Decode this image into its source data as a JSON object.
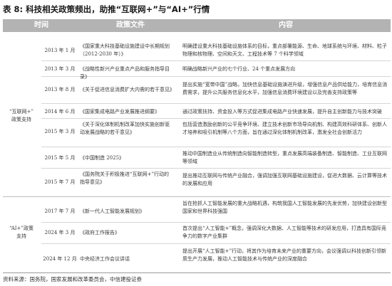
{
  "table": {
    "title_prefix": "表 8:",
    "title_text": "科技相关政策频出，助推“互联网+”与“AI+”行情",
    "headers": {
      "time": "时间",
      "policy": "政策文件",
      "content": "内容"
    },
    "groups": [
      {
        "label_line1": "“互联网+”",
        "label_line2": "政策支持"
      },
      {
        "label_line1": "“AI+”政策",
        "label_line2": "支持"
      }
    ],
    "rows": [
      {
        "date": "2013 年 1 月",
        "policy": "《国家重大科技基础设施建设中长期规划（2012-2030 年）》",
        "content": "明确建设重大科技基础设施体系的目标，重点部署能源、生命、地球系统与环境、材料、粒子物理和核物理、空间和天文、工程技术等 7 个科学领域"
      },
      {
        "date": "2013 年 3 月",
        "policy": "《战略性新兴产业重点产品和服务指导目录》",
        "content": "明确战略新兴产业的七个行业、24 个重点发展方向"
      },
      {
        "date": "2013 年 8 月",
        "policy": "《关于促进信息消费扩大内需的若干意见》",
        "content": "提出实施“宽带中国”战略，加快信息基础设施演进升级，增强信息产品供给能力，培育信息消费需求，提升公共服务信息化水平，加强信息消费环境建设以及完善支持政策等"
      },
      {
        "date": "2014 年 6 月",
        "policy": "《国家集成电路产业发展推进纲要》",
        "content": "通过政策扶持、资金投入等方式促进集成电路产业快速发展，提升自主创新能力与技术突破"
      },
      {
        "date": "2015 年 3 月",
        "policy": "《关于深化体制机制改革加快实施创新驱动发展战略的若干意见》",
        "content": "包括营造激励创新的公平竞争环境、建立技术创新市场导向机制、构建高效科研体系、创新人才培养和吸引机制等八个方面，旨在通过深化体制机制改革，激发全社会创新活力"
      },
      {
        "date": "2015 年 5 月",
        "policy": "《中国制造 2025》",
        "content": "推动中国制造业从传统制造向智能制造转型，重点发展高端装备制造、智能制造、工业互联网等领域"
      },
      {
        "date": "2015 年 7 月",
        "policy": "《国务院关于积极推进“互联网+”行动的指导意见》",
        "content": "提出推动互联网与传统产业融合，强调加强互联网基础设施建设，促进大数据、云计算等技术的发展和应用"
      },
      {
        "date": "2017 年 7 月",
        "policy": "《新一代人工智能发展规划》",
        "content": "旨在抢抓人工智能发展的重大战略机遇，构筑我国人工智能发展的先发优势，加快建设创新型国家和世界科技强国"
      },
      {
        "date": "2024 年 3 月",
        "policy": "《政府工作报告》",
        "content": "首次提出“人工智能+”概念，强调深化大数据、人工智能等技术的研发应用，打造具有国际竞争力的数字产业集群"
      },
      {
        "date": "2024 年 12 月",
        "policy": "中央经济工作会议讲话",
        "content": "提出开展“人工智能+”行动，将其作为培育未来产业的重要方向，会议强调以科技创新引领新质生产力发展，推动人工智能技术与传统产业的深度融合"
      }
    ],
    "source": "资料来源：国务院，国家发展和改革委员会，中信建投证券"
  }
}
